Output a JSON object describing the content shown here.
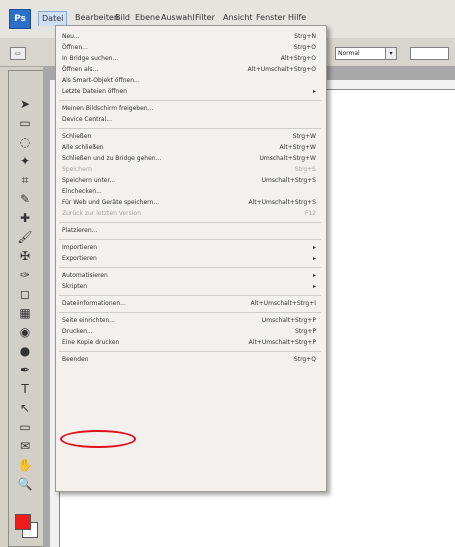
{
  "app": {
    "logo": "Ps"
  },
  "menubar": {
    "items": [
      "Datei",
      "Bearbeiten",
      "Bild",
      "Ebene",
      "Auswahl",
      "Filter",
      "Ansicht",
      "Fenster",
      "Hilfe"
    ],
    "active": "Datei"
  },
  "options_bar": {
    "field1": "Normal"
  },
  "toolbox": {
    "icons": [
      "move-icon",
      "marquee-icon",
      "lasso-icon",
      "magic-wand-icon",
      "crop-icon",
      "eyedropper-icon",
      "healing-brush-icon",
      "brush-icon",
      "clone-stamp-icon",
      "history-brush-icon",
      "eraser-icon",
      "gradient-icon",
      "blur-icon",
      "dodge-icon",
      "pen-icon",
      "type-icon",
      "path-select-icon",
      "shape-icon",
      "notes-icon",
      "hand-icon",
      "zoom-icon"
    ],
    "foreground_color": "#ef1c1c",
    "background_color": "#ffffff"
  },
  "file_menu": {
    "items": [
      {
        "label": "Neu...",
        "shortcut": "Strg+N"
      },
      {
        "label": "Öffnen...",
        "shortcut": "Strg+O"
      },
      {
        "label": "In Bridge suchen...",
        "shortcut": "Alt+Strg+O"
      },
      {
        "label": "Öffnen als...",
        "shortcut": "Alt+Umschalt+Strg+O"
      },
      {
        "label": "Als Smart-Objekt öffnen...",
        "shortcut": ""
      },
      {
        "label": "Letzte Dateien öffnen",
        "shortcut": "",
        "submenu": true
      },
      {
        "sep": true
      },
      {
        "label": "Meinen Bildschirm freigeben...",
        "shortcut": ""
      },
      {
        "label": "Device Central...",
        "shortcut": ""
      },
      {
        "sep": true
      },
      {
        "label": "Schließen",
        "shortcut": "Strg+W"
      },
      {
        "label": "Alle schließen",
        "shortcut": "Alt+Strg+W"
      },
      {
        "label": "Schließen und zu Bridge gehen...",
        "shortcut": "Umschalt+Strg+W"
      },
      {
        "label": "Speichern",
        "shortcut": "Strg+S",
        "disabled": true
      },
      {
        "label": "Speichern unter...",
        "shortcut": "Umschalt+Strg+S"
      },
      {
        "label": "Einchecken...",
        "shortcut": ""
      },
      {
        "label": "Für Web und Geräte speichern...",
        "shortcut": "Alt+Umschalt+Strg+S"
      },
      {
        "label": "Zurück zur letzten Version",
        "shortcut": "F12",
        "disabled": true
      },
      {
        "sep": true
      },
      {
        "label": "Platzieren...",
        "shortcut": ""
      },
      {
        "sep": true
      },
      {
        "label": "Importieren",
        "shortcut": "",
        "submenu": true
      },
      {
        "label": "Exportieren",
        "shortcut": "",
        "submenu": true
      },
      {
        "sep": true
      },
      {
        "label": "Automatisieren",
        "shortcut": "",
        "submenu": true
      },
      {
        "label": "Skripten",
        "shortcut": "",
        "submenu": true
      },
      {
        "sep": true
      },
      {
        "label": "Dateiinformationen...",
        "shortcut": "Alt+Umschalt+Strg+I"
      },
      {
        "sep": true
      },
      {
        "label": "Seite einrichten...",
        "shortcut": "Umschalt+Strg+P"
      },
      {
        "label": "Drucken...",
        "shortcut": "Strg+P"
      },
      {
        "label": "Eine Kopie drucken",
        "shortcut": "Alt+Umschalt+Strg+P"
      },
      {
        "sep": true
      },
      {
        "label": "Beenden",
        "shortcut": "Strg+Q"
      }
    ]
  }
}
